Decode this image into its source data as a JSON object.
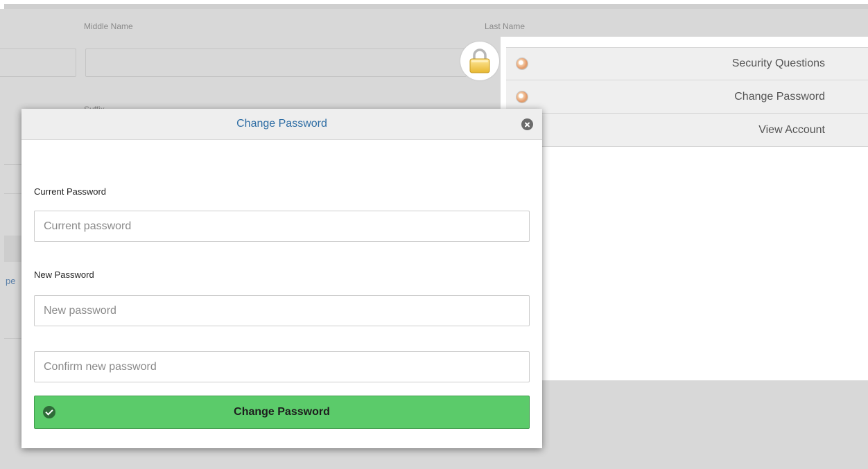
{
  "background_form": {
    "middle_name_label": "Middle Name",
    "last_name_label": "Last Name",
    "suffix_label": "Suffix",
    "clipped_link_text": "pe"
  },
  "account_menu": {
    "items": [
      {
        "label": "Security Questions",
        "icon": "security-questions-icon"
      },
      {
        "label": "Change Password",
        "icon": "change-password-icon"
      },
      {
        "label": "View Account",
        "icon": "view-account-icon"
      }
    ]
  },
  "modal": {
    "title": "Change Password",
    "current_password": {
      "label": "Current Password",
      "placeholder": "Current password",
      "value": ""
    },
    "new_password": {
      "label": "New Password",
      "placeholder": "New password",
      "value": ""
    },
    "confirm_password": {
      "placeholder": "Confirm new password",
      "value": ""
    },
    "submit_label": "Change Password"
  },
  "colors": {
    "submit_green": "#5bcb6a",
    "title_blue": "#2e6da4",
    "overlay_gray": "#d8d8d8"
  }
}
